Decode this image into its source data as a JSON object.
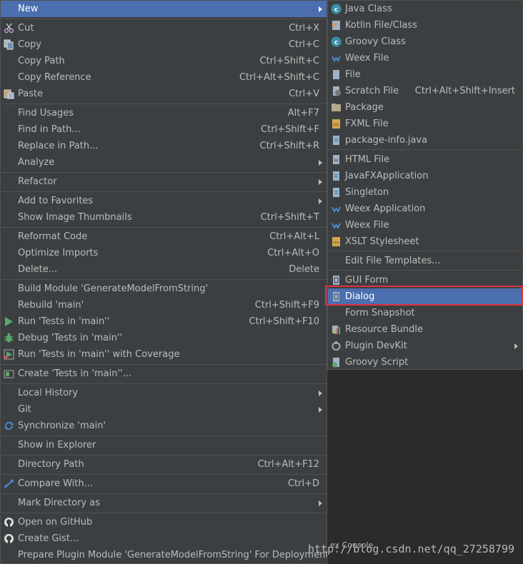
{
  "main_menu": {
    "items": [
      {
        "label": "New",
        "shortcut": "",
        "submenu": true
      },
      {
        "label": "Cut",
        "shortcut": "Ctrl+X"
      },
      {
        "label": "Copy",
        "shortcut": "Ctrl+C"
      },
      {
        "label": "Copy Path",
        "shortcut": "Ctrl+Shift+C"
      },
      {
        "label": "Copy Reference",
        "shortcut": "Ctrl+Alt+Shift+C"
      },
      {
        "label": "Paste",
        "shortcut": "Ctrl+V"
      },
      {
        "label": "Find Usages",
        "shortcut": "Alt+F7"
      },
      {
        "label": "Find in Path...",
        "shortcut": "Ctrl+Shift+F"
      },
      {
        "label": "Replace in Path...",
        "shortcut": "Ctrl+Shift+R"
      },
      {
        "label": "Analyze",
        "shortcut": "",
        "submenu": true
      },
      {
        "label": "Refactor",
        "shortcut": "",
        "submenu": true
      },
      {
        "label": "Add to Favorites",
        "shortcut": "",
        "submenu": true
      },
      {
        "label": "Show Image Thumbnails",
        "shortcut": "Ctrl+Shift+T"
      },
      {
        "label": "Reformat Code",
        "shortcut": "Ctrl+Alt+L"
      },
      {
        "label": "Optimize Imports",
        "shortcut": "Ctrl+Alt+O"
      },
      {
        "label": "Delete...",
        "shortcut": "Delete"
      },
      {
        "label": "Build Module 'GenerateModelFromString'",
        "shortcut": ""
      },
      {
        "label": "Rebuild 'main'",
        "shortcut": "Ctrl+Shift+F9"
      },
      {
        "label": "Run 'Tests in 'main''",
        "shortcut": "Ctrl+Shift+F10"
      },
      {
        "label": "Debug 'Tests in 'main''",
        "shortcut": ""
      },
      {
        "label": "Run 'Tests in 'main'' with Coverage",
        "shortcut": ""
      },
      {
        "label": "Create 'Tests in 'main''...",
        "shortcut": ""
      },
      {
        "label": "Local History",
        "shortcut": "",
        "submenu": true
      },
      {
        "label": "Git",
        "shortcut": "",
        "submenu": true
      },
      {
        "label": "Synchronize 'main'",
        "shortcut": ""
      },
      {
        "label": "Show in Explorer",
        "shortcut": ""
      },
      {
        "label": "Directory Path",
        "shortcut": "Ctrl+Alt+F12"
      },
      {
        "label": "Compare With...",
        "shortcut": "Ctrl+D"
      },
      {
        "label": "Mark Directory as",
        "shortcut": "",
        "submenu": true
      },
      {
        "label": "Open on GitHub",
        "shortcut": ""
      },
      {
        "label": "Create Gist...",
        "shortcut": ""
      },
      {
        "label": "Prepare Plugin Module 'GenerateModelFromString' For Deployment",
        "shortcut": ""
      }
    ]
  },
  "sub_menu": {
    "items": [
      {
        "label": "Java Class",
        "shortcut": ""
      },
      {
        "label": "Kotlin File/Class",
        "shortcut": ""
      },
      {
        "label": "Groovy Class",
        "shortcut": ""
      },
      {
        "label": "Weex File",
        "shortcut": ""
      },
      {
        "label": "File",
        "shortcut": ""
      },
      {
        "label": "Scratch File",
        "shortcut": "Ctrl+Alt+Shift+Insert"
      },
      {
        "label": "Package",
        "shortcut": ""
      },
      {
        "label": "FXML File",
        "shortcut": ""
      },
      {
        "label": "package-info.java",
        "shortcut": ""
      },
      {
        "label": "HTML File",
        "shortcut": ""
      },
      {
        "label": "JavaFXApplication",
        "shortcut": ""
      },
      {
        "label": "Singleton",
        "shortcut": ""
      },
      {
        "label": "Weex Application",
        "shortcut": ""
      },
      {
        "label": "Weex File",
        "shortcut": ""
      },
      {
        "label": "XSLT Stylesheet",
        "shortcut": ""
      },
      {
        "label": "Edit File Templates...",
        "shortcut": ""
      },
      {
        "label": "GUI Form",
        "shortcut": ""
      },
      {
        "label": "Dialog",
        "shortcut": ""
      },
      {
        "label": "Form Snapshot",
        "shortcut": ""
      },
      {
        "label": "Resource Bundle",
        "shortcut": ""
      },
      {
        "label": "Plugin DevKit",
        "shortcut": "",
        "submenu": true
      },
      {
        "label": "Groovy Script",
        "shortcut": ""
      }
    ]
  },
  "bottom_strip": {
    "text": "ex Console"
  },
  "watermark": "http://blog.csdn.net/qq_27258799",
  "colors": {
    "menu_bg": "#3c3f41",
    "highlight": "#4b6eaf",
    "text": "#bbbbbb",
    "separator": "#515151",
    "annotation_frame": "#e0323c"
  }
}
